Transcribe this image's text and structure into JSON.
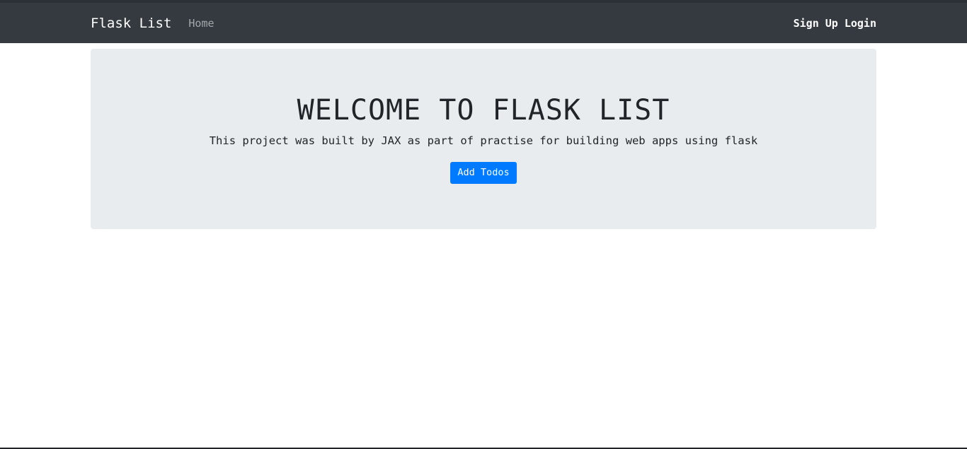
{
  "navbar": {
    "brand": "Flask List",
    "home": "Home",
    "signup": "Sign Up",
    "login": "Login"
  },
  "jumbotron": {
    "title": "WELCOME TO FLASK LIST",
    "text": "This project was built by JAX as part of practise for building web apps using flask",
    "button": "Add Todos"
  },
  "colors": {
    "navbar_bg": "#343a40",
    "jumbotron_bg": "#e9ecef",
    "primary": "#007bff"
  }
}
